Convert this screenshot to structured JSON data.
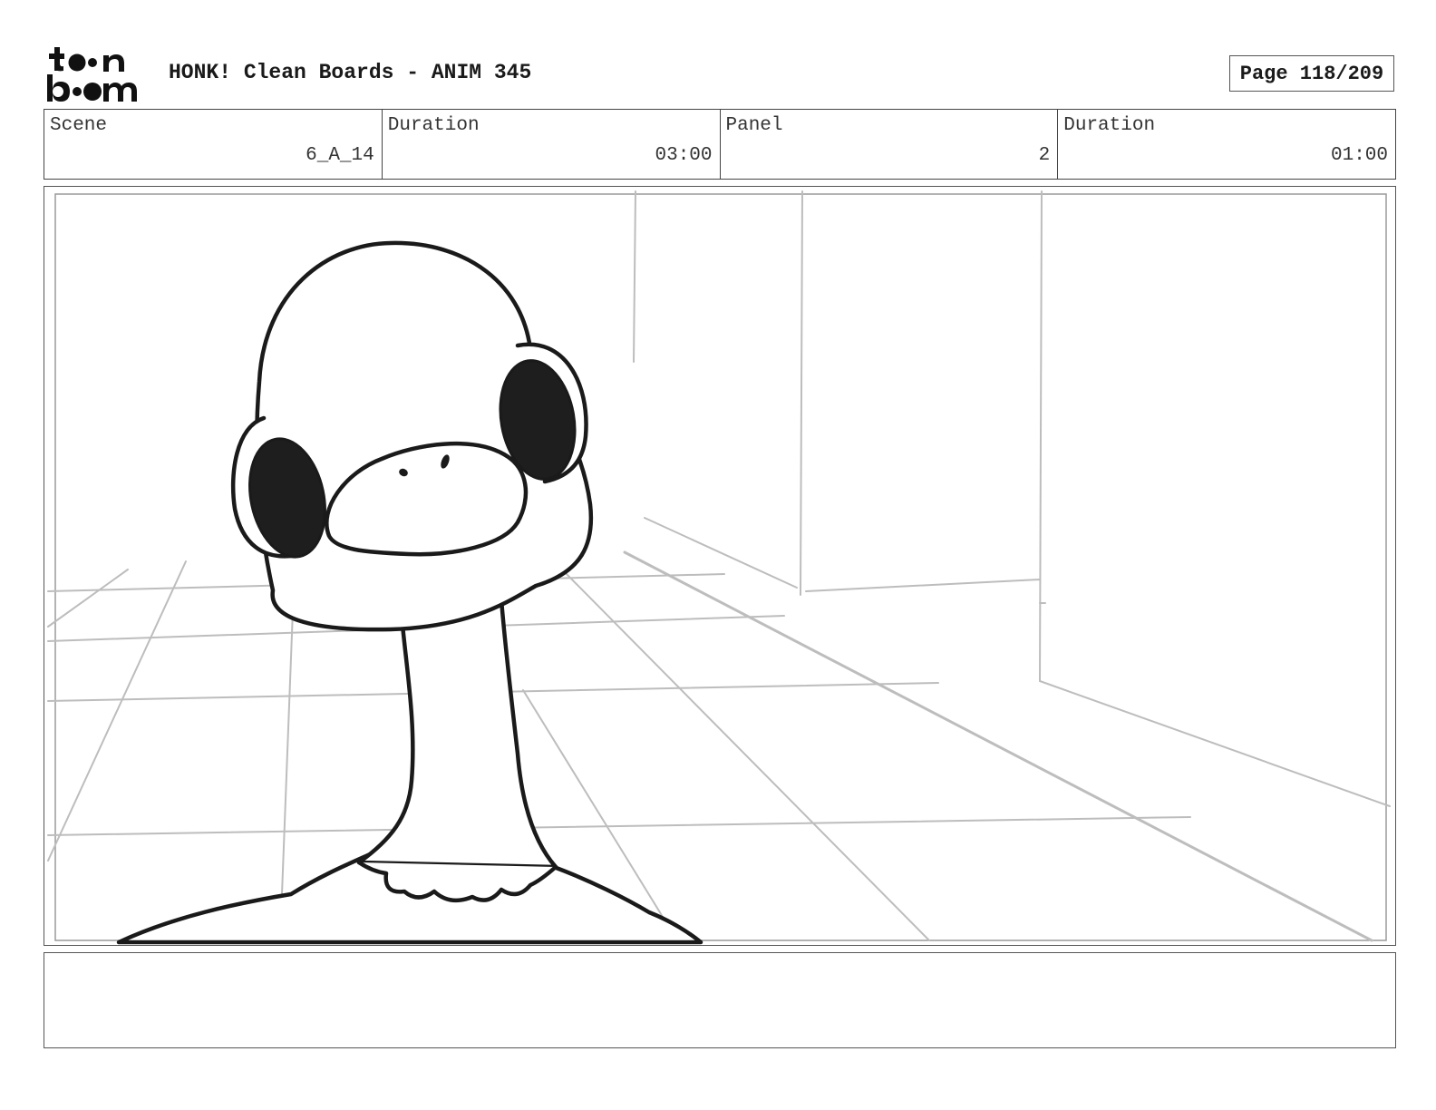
{
  "header": {
    "logo_text": "toon boom",
    "title": "HONK! Clean Boards - ANIM 345",
    "page_label": "Page 118/209"
  },
  "info": {
    "scene_label": "Scene",
    "scene_value": "6_A_14",
    "scene_duration_label": "Duration",
    "scene_duration_value": "03:00",
    "panel_label": "Panel",
    "panel_value": "2",
    "panel_duration_label": "Duration",
    "panel_duration_value": "01:00"
  },
  "notes": {
    "text": ""
  },
  "colors": {
    "ink": "#1a1a1a",
    "background_lines": "#bdbdbd",
    "border": "#555555"
  }
}
